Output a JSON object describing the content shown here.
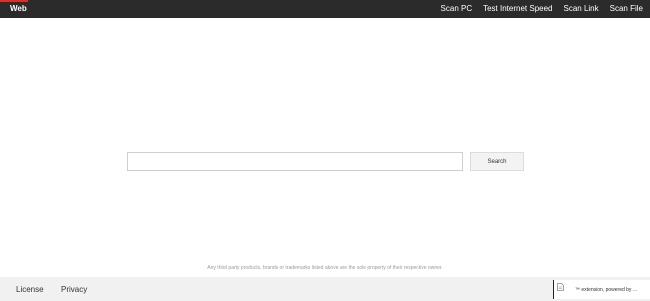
{
  "header": {
    "brand": "Web",
    "nav": [
      "Scan PC",
      "Test Internet Speed",
      "Scan Link",
      "Scan File"
    ]
  },
  "search": {
    "value": "",
    "placeholder": "",
    "button_label": "Search"
  },
  "disclaimer": "Any third party products, brands or trademarks listed above are the sole property of their respective owner.",
  "footer": {
    "links": [
      "License",
      "Privacy"
    ],
    "extension_text": "™ extension, powered by ..."
  },
  "colors": {
    "topbar": "#2b2b2b",
    "accent": "#d9302c",
    "footer": "#f1f1f1"
  },
  "icons": [
    "document-icon"
  ]
}
